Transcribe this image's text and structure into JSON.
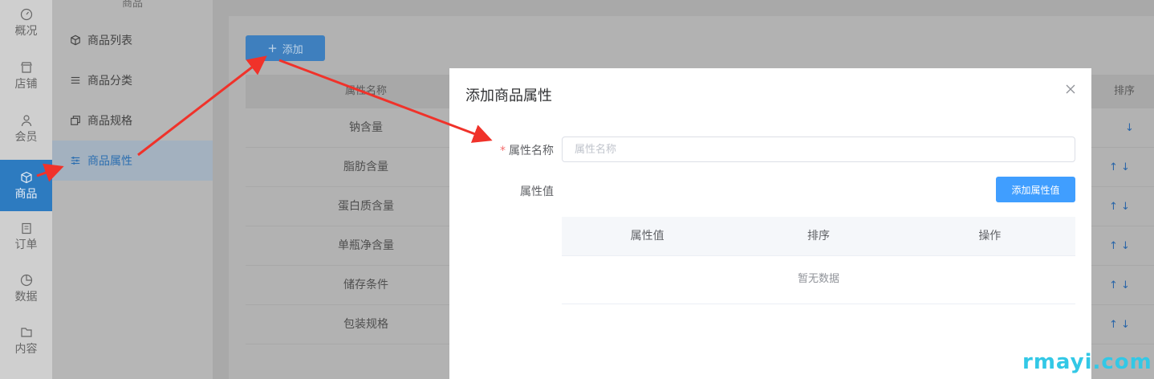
{
  "primary_nav": [
    {
      "label": "概况",
      "icon": "gauge-icon"
    },
    {
      "label": "店铺",
      "icon": "store-icon"
    },
    {
      "label": "会员",
      "icon": "user-icon"
    },
    {
      "label": "商品",
      "icon": "cube-icon",
      "active": true
    },
    {
      "label": "订单",
      "icon": "clipboard-icon"
    },
    {
      "label": "数据",
      "icon": "pie-chart-icon"
    },
    {
      "label": "内容",
      "icon": "folder-icon"
    }
  ],
  "secondary_nav": {
    "heading": "商品",
    "items": [
      {
        "label": "商品列表",
        "icon": "cube-outline-icon"
      },
      {
        "label": "商品分类",
        "icon": "list-icon"
      },
      {
        "label": "商品规格",
        "icon": "copy-icon"
      },
      {
        "label": "商品属性",
        "icon": "sliders-icon",
        "active": true
      }
    ]
  },
  "toolbar": {
    "add_label": "添加"
  },
  "table": {
    "columns": {
      "name": "属性名称",
      "sort": "排序"
    },
    "rows": [
      {
        "name": "钠含量",
        "sort": "↓"
      },
      {
        "name": "脂肪含量",
        "sort": "↑ ↓"
      },
      {
        "name": "蛋白质含量",
        "sort": "↑ ↓"
      },
      {
        "name": "单瓶净含量",
        "sort": "↑ ↓"
      },
      {
        "name": "储存条件",
        "sort": "↑ ↓"
      },
      {
        "name": "包装规格",
        "sort": "↑ ↓"
      }
    ]
  },
  "modal": {
    "title": "添加商品属性",
    "name_label": "属性名称",
    "name_placeholder": "属性名称",
    "name_value": "",
    "values_label": "属性值",
    "add_value_button": "添加属性值",
    "values_table": {
      "columns": [
        "属性值",
        "排序",
        "操作"
      ],
      "empty_text": "暂无数据"
    }
  },
  "watermark": "rmayi.com",
  "colors": {
    "primary": "#409eff",
    "required_star": "#f56c6c",
    "annotation_arrow": "#f0322a",
    "watermark": "#32c8e6"
  }
}
